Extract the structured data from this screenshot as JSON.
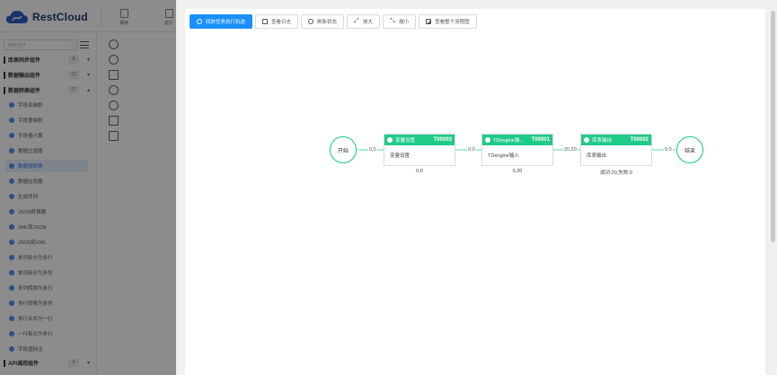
{
  "app": {
    "brand": "RestCloud",
    "toolbar_buttons": [
      "保存",
      "运行"
    ]
  },
  "sidebar": {
    "search_placeholder": "搜索组件",
    "groups": [
      {
        "label": "库表同步组件",
        "count": "8",
        "chevron": "▾"
      },
      {
        "label": "数据输出组件",
        "count": "12",
        "chevron": "▾"
      },
      {
        "label": "数据转换组件",
        "count": "17",
        "chevron": "▴"
      }
    ],
    "items": [
      "字段名映射",
      "字段值映射",
      "字段值计算",
      "数据过滤器",
      "数据流转换",
      "数据比较器",
      "生成序列",
      "JSON转换器",
      "XML转JSON",
      "JSON转XML",
      "单列拆分为多行",
      "单列拆分为多列",
      "多列转换为多行",
      "多行转换为多列",
      "多行合并为一行",
      "一行拆分为多行",
      "字段值标注"
    ],
    "active_index": 4,
    "bottom_group": {
      "label": "API调用组件",
      "count": "6",
      "chevron": "▾"
    }
  },
  "drawer": {
    "toolbar": [
      {
        "label": "回放任务执行轨迹",
        "icon": "replay-icon",
        "primary": true
      },
      {
        "label": "查看日志",
        "icon": "log-icon"
      },
      {
        "label": "刷新状态",
        "icon": "refresh-icon"
      },
      {
        "label": "放大",
        "icon": "expand-icon"
      },
      {
        "label": "缩小",
        "icon": "shrink-icon"
      },
      {
        "label": "查看整个流程图",
        "icon": "fit-view-icon"
      }
    ],
    "flow": {
      "start_label": "开始",
      "end_label": "结束",
      "nodes": [
        {
          "title": "变量设置",
          "id": "T00003",
          "body": "变量设置",
          "stat": "0,0"
        },
        {
          "title": "TDengine输...",
          "id": "T00001",
          "body": "TDengine输入",
          "stat": "0,20"
        },
        {
          "title": "库表输出",
          "id": "T00002",
          "body": "库表输出",
          "stat": "成功:20,失败:0"
        }
      ],
      "edges": [
        "0,0",
        "0,0",
        "20,20",
        "0,0"
      ]
    }
  },
  "colors": {
    "primary": "#1890ff",
    "node_green": "#1fcb88",
    "mask": "rgba(0,0,0,0.45)",
    "brand_blue": "#1e3a6e"
  }
}
